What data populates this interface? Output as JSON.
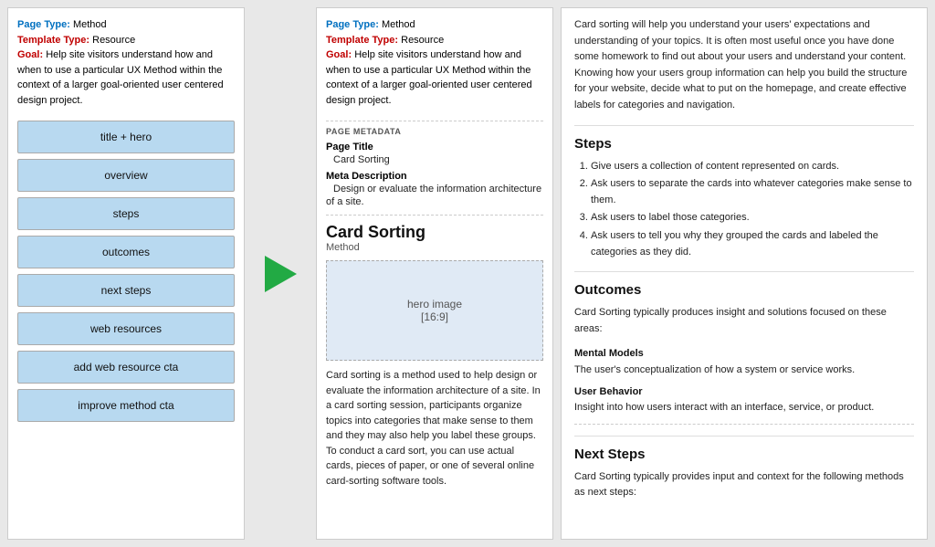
{
  "leftPanel": {
    "meta": {
      "pageTypeLabel": "Page Type:",
      "pageTypeValue": "Method",
      "templateTypeLabel": "Template Type:",
      "templateTypeValue": "Resource",
      "goalLabel": "Goal:",
      "goalValue": "Help site visitors understand how and when to use a particular UX Method within the context of a larger goal-oriented user centered design project."
    },
    "navItems": [
      "title + hero",
      "overview",
      "steps",
      "outcomes",
      "next steps",
      "web resources",
      "add web resource cta",
      "improve method cta"
    ]
  },
  "middlePanel": {
    "meta": {
      "pageTypeLabel": "Page Type:",
      "pageTypeValue": "Method",
      "templateTypeLabel": "Template Type:",
      "templateTypeValue": "Resource",
      "goalLabel": "Goal:",
      "goalValue": "Help site visitors understand how and when to use a particular UX Method within the context of a larger goal-oriented user centered design project."
    },
    "pageMetadataLabel": "PAGE METADATA",
    "pageTitleLabel": "Page Title",
    "pageTitleValue": "Card Sorting",
    "metaDescLabel": "Meta Description",
    "metaDescValue": "Design or evaluate the information architecture of a site.",
    "cardTitle": "Card Sorting",
    "cardType": "Method",
    "heroPlaceholder": "hero image",
    "heroRatio": "[16:9]",
    "bodyText": "Card sorting is a method used to help design or evaluate the information architecture of a site. In a card sorting session, participants organize topics into categories that make sense to them and they may also help you label these groups. To conduct a card sort, you can use actual cards, pieces of paper, or one of several online card-sorting software tools."
  },
  "rightPanel": {
    "introParagraph": "Card sorting will help you understand your users' expectations and understanding of your topics. It is often most useful once you have done some homework to find out about your users and understand your content. Knowing how your users group information can help you build the structure for your website, decide what to put on the homepage, and create effective labels for categories and navigation.",
    "stepsTitle": "Steps",
    "steps": [
      "Give users a collection of content represented on cards.",
      "Ask users to separate the cards into whatever categories make sense to them.",
      "Ask users to label those categories.",
      "Ask users to tell you why they grouped the cards and labeled the categories as they did."
    ],
    "outcomesTitle": "Outcomes",
    "outcomesIntro": "Card Sorting typically produces insight and solutions focused on these areas:",
    "outcomeItems": [
      {
        "title": "Mental Models",
        "text": "The user's conceptualization of how a system or service works."
      },
      {
        "title": "User Behavior",
        "text": "Insight into how users interact with an interface, service, or product."
      }
    ],
    "nextStepsTitle": "Next Steps",
    "nextStepsText": "Card Sorting typically provides input and context for the following methods as next steps:"
  }
}
